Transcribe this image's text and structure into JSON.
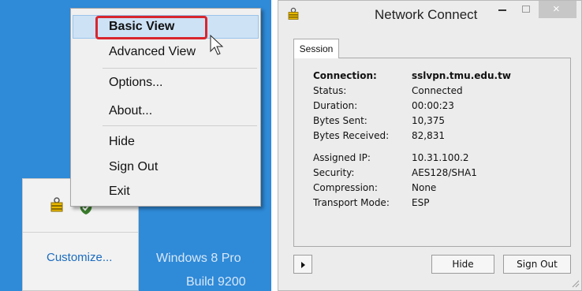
{
  "desktop": {
    "customize_label": "Customize...",
    "edition_text": "Windows 8 Pro",
    "build_text": "Build 9200"
  },
  "context_menu": {
    "items": [
      {
        "label": "Basic View"
      },
      {
        "label": "Advanced View"
      },
      {
        "label": "Options..."
      },
      {
        "label": "About..."
      },
      {
        "label": "Hide"
      },
      {
        "label": "Sign Out"
      },
      {
        "label": "Exit"
      }
    ]
  },
  "window": {
    "title": "Network Connect",
    "tab_label": "Session",
    "connection": {
      "label": "Connection:",
      "value": "sslvpn.tmu.edu.tw"
    },
    "status": {
      "label": "Status:",
      "value": "Connected"
    },
    "duration": {
      "label": "Duration:",
      "value": "00:00:23"
    },
    "bytes_sent": {
      "label": "Bytes Sent:",
      "value": "10,375"
    },
    "bytes_received": {
      "label": "Bytes Received:",
      "value": "82,831"
    },
    "assigned_ip": {
      "label": "Assigned IP:",
      "value": "10.31.100.2"
    },
    "security": {
      "label": "Security:",
      "value": "AES128/SHA1"
    },
    "compression": {
      "label": "Compression:",
      "value": "None"
    },
    "transport_mode": {
      "label": "Transport Mode:",
      "value": "ESP"
    },
    "hide_button": "Hide",
    "signout_button": "Sign Out",
    "close_glyph": "×"
  },
  "colors": {
    "desktop_bg": "#2f8ad8",
    "menu_highlight": "#cde2f5",
    "focus_ring": "#d8262e",
    "link": "#1a6bbf"
  },
  "icons": [
    "lock-icon",
    "shield-check-icon",
    "cursor-icon",
    "expand-arrow-icon",
    "minimize-icon",
    "maximize-icon",
    "close-icon",
    "resize-grip-icon"
  ]
}
